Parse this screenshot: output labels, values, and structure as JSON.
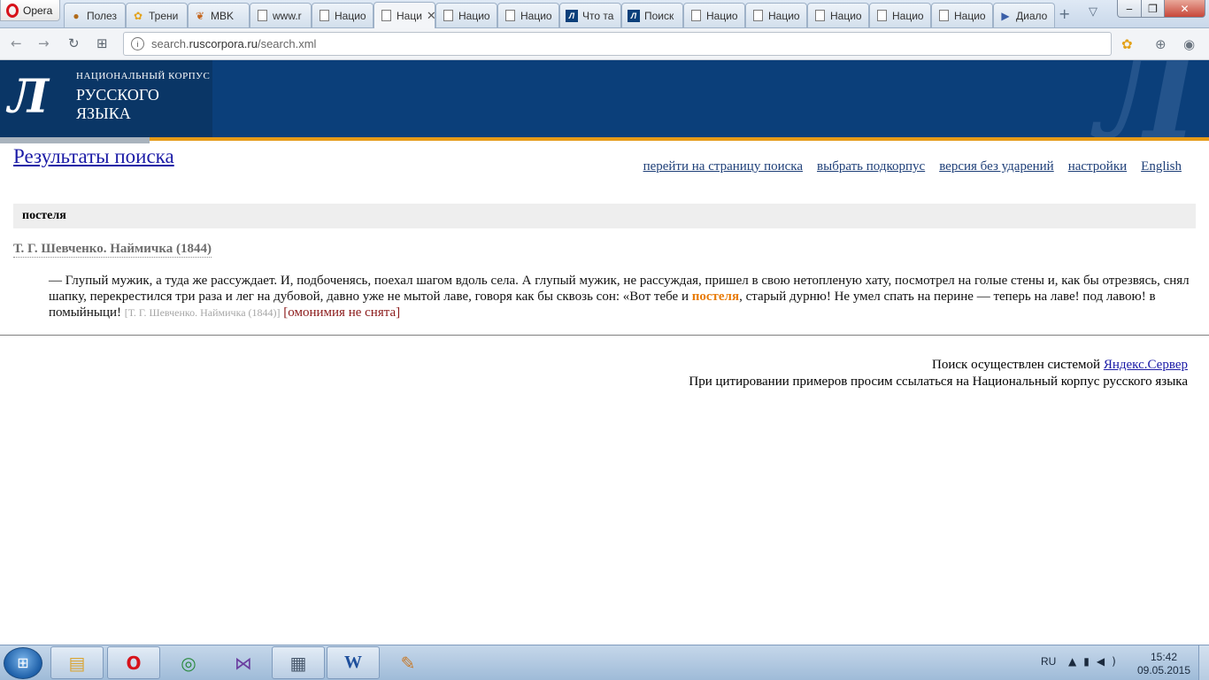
{
  "browser": {
    "menu_label": "Opera",
    "tabs": [
      {
        "label": "Полез",
        "icon": "acorn-icon"
      },
      {
        "label": "Трени",
        "icon": "flower-icon"
      },
      {
        "label": "MBK",
        "icon": "leaf-icon"
      },
      {
        "label": "www.r",
        "icon": "document-icon"
      },
      {
        "label": "Нацио",
        "icon": "document-icon"
      },
      {
        "label": "Наци",
        "icon": "document-icon",
        "active": true
      },
      {
        "label": "Нацио",
        "icon": "document-icon"
      },
      {
        "label": "Нацио",
        "icon": "document-icon"
      },
      {
        "label": "Что та",
        "icon": "ruscorpora-icon"
      },
      {
        "label": "Поиск",
        "icon": "ruscorpora-icon"
      },
      {
        "label": "Нацио",
        "icon": "document-icon"
      },
      {
        "label": "Нацио",
        "icon": "document-icon"
      },
      {
        "label": "Нацио",
        "icon": "document-icon"
      },
      {
        "label": "Нацио",
        "icon": "document-icon"
      },
      {
        "label": "Нацио",
        "icon": "document-icon"
      },
      {
        "label": "Диало",
        "icon": "dialog-icon"
      }
    ],
    "address": {
      "prefix": "search.",
      "host": "ruscorpora.ru",
      "path": "/search.xml"
    }
  },
  "site": {
    "logo": {
      "mark": "Л",
      "line1": "НАЦИОНАЛЬНЫЙ КОРПУС",
      "line2": "РУССКОГО",
      "line3": "ЯЗЫКА"
    },
    "page_title": "Результаты поиска",
    "nav_links": [
      {
        "label": "перейти на страницу поиска"
      },
      {
        "label": "выбрать подкорпус"
      },
      {
        "label": "версия без ударений"
      },
      {
        "label": "настройки"
      },
      {
        "label": "English"
      }
    ],
    "query": "постеля",
    "result": {
      "doc_title": "Т. Г. Шевченко. Наймичка (1844)",
      "text_before": "— Глупый мужик, а туда же рассуждает. И, подбоченясь, поехал шагом вдоль села. А глупый мужик, не рассуждая, пришел в свою нетопленую хату, посмотрел на голые стены и, как бы отрезвясь, снял шапку, перекрестился три раза и лег на дубовой, давно уже не мытой лаве, говоря как бы сквозь сон: «Вот тебе и ",
      "hit_word": "постеля",
      "text_after": ", старый дурню! Не умел спать на перине — теперь на лаве! под лавою! в помыйныци! ",
      "source": "[Т. Г. Шевченко. Наймичка (1844)]",
      "homonymy": "[омонимия не снята]"
    },
    "footer": {
      "line1_text": "Поиск осуществлен системой ",
      "line1_link": "Яндекс.Сервер",
      "line2": "При цитировании примеров просим ссылаться на Национальный корпус русского языка"
    }
  },
  "taskbar": {
    "language": "RU",
    "time": "15:42",
    "date": "09.05.2015"
  },
  "colors": {
    "header_blue": "#0b3f7a",
    "accent_orange": "#e59b18",
    "hit_orange": "#e87c0a",
    "link_blue": "#1a1aa6"
  }
}
